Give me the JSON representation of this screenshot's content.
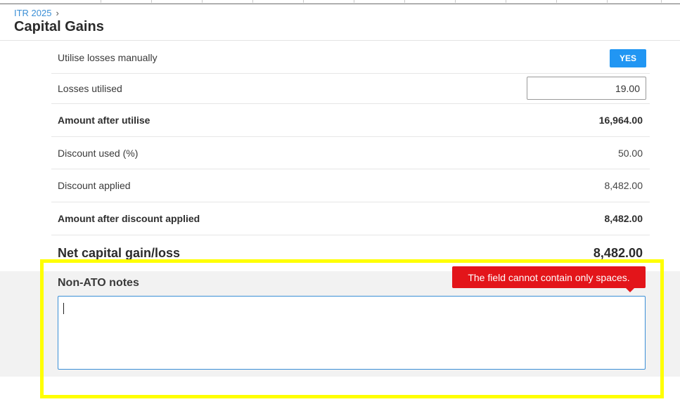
{
  "header": {
    "breadcrumb": "ITR 2025",
    "breadcrumb_chevron": "›",
    "title": "Capital Gains"
  },
  "rows": [
    {
      "label": "Utilise losses manually",
      "toggle": "YES"
    },
    {
      "label": "Losses utilised",
      "input_value": "19.00"
    },
    {
      "label": "Amount after utilise",
      "value": "16,964.00"
    },
    {
      "label": "Discount used (%)",
      "value": "50.00"
    },
    {
      "label": "Discount applied",
      "value": "8,482.00"
    },
    {
      "label": "Amount after discount applied",
      "value": "8,482.00"
    }
  ],
  "net": {
    "label": "Net capital gain/loss",
    "value": "8,482.00"
  },
  "notes": {
    "label": "Non-ATO notes",
    "value": "",
    "error": "The field cannot contain only spaces."
  },
  "colors": {
    "accent": "#2196f3",
    "link": "#3b8fd6",
    "error": "#e3151a",
    "highlight": "#ffff00"
  }
}
